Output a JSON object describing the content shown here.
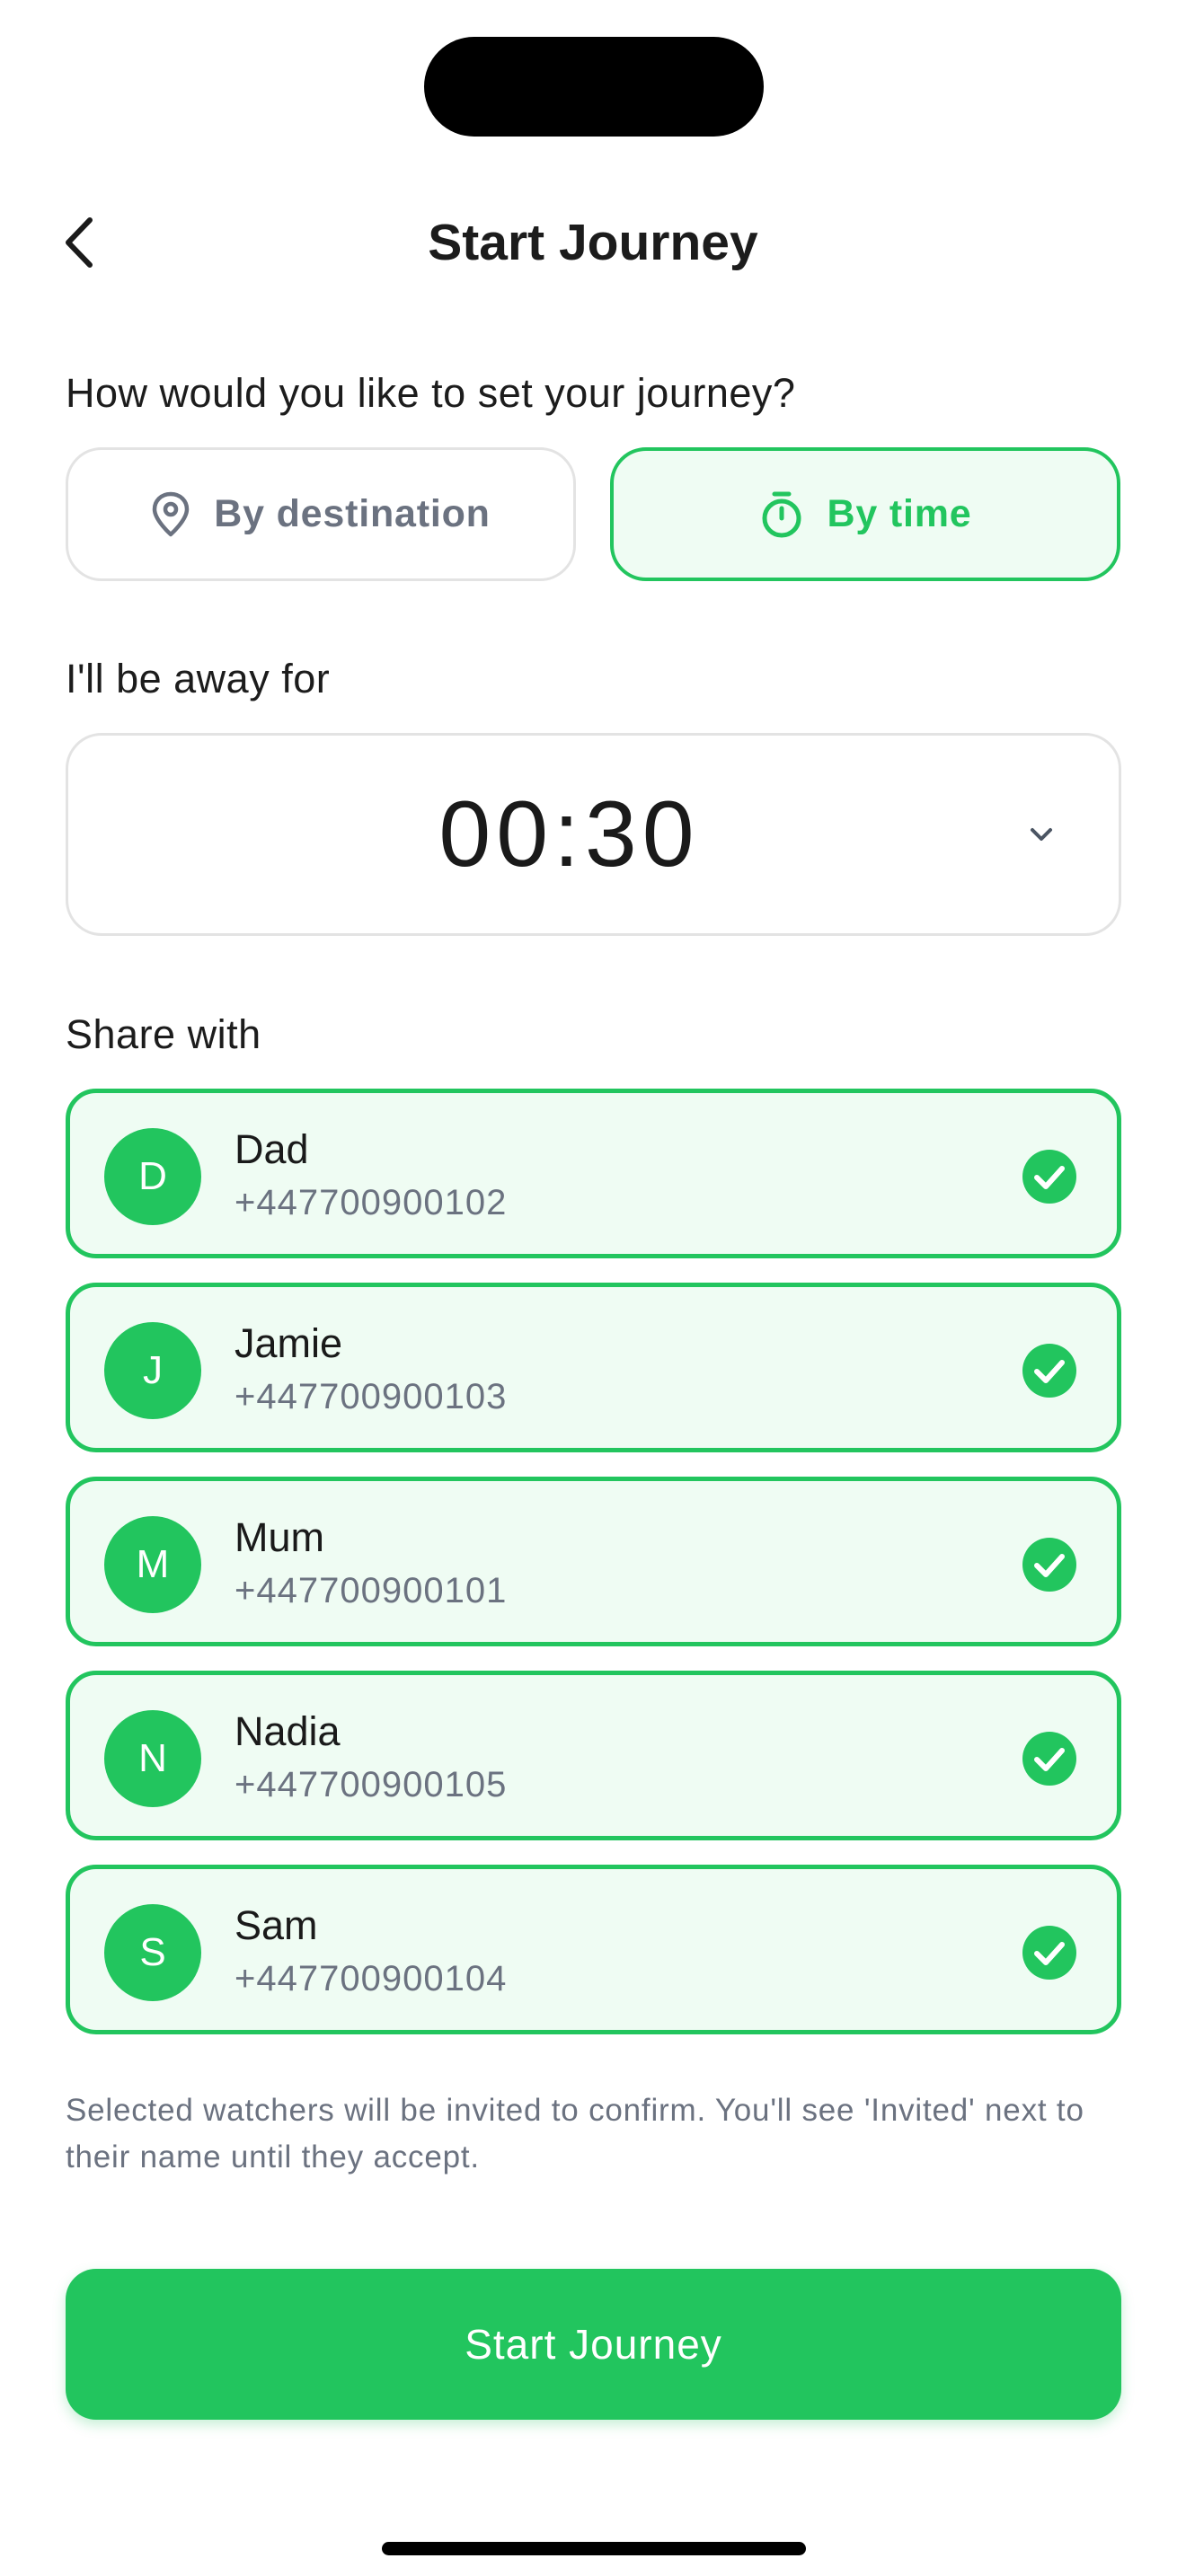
{
  "header": {
    "title": "Start Journey",
    "back_icon": "chevron-left-icon"
  },
  "mode": {
    "question": "How would you like to set your journey?",
    "options": [
      {
        "label": "By destination",
        "icon": "location-pin-icon",
        "selected": false
      },
      {
        "label": "By time",
        "icon": "stopwatch-icon",
        "selected": true
      }
    ]
  },
  "duration": {
    "label": "I'll be away for",
    "value": "00:30",
    "icon": "chevron-down-icon"
  },
  "share": {
    "label": "Share with",
    "contacts": [
      {
        "initial": "D",
        "name": "Dad",
        "phone": "+447700900102",
        "selected": true
      },
      {
        "initial": "J",
        "name": "Jamie",
        "phone": "+447700900103",
        "selected": true
      },
      {
        "initial": "M",
        "name": "Mum",
        "phone": "+447700900101",
        "selected": true
      },
      {
        "initial": "N",
        "name": "Nadia",
        "phone": "+447700900105",
        "selected": true
      },
      {
        "initial": "S",
        "name": "Sam",
        "phone": "+447700900104",
        "selected": true
      }
    ]
  },
  "note": "Selected watchers will be invited to confirm. You'll see 'Invited' next to their name until they accept.",
  "cta": {
    "label": "Start Journey"
  },
  "colors": {
    "accent": "#22c55e",
    "accent_bg": "#effcf3",
    "muted_text": "#6b7280",
    "border": "#e3e3e3"
  }
}
